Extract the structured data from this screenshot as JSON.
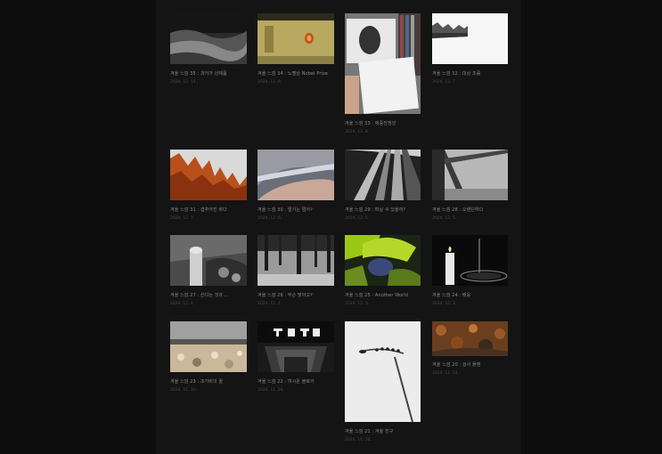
{
  "posts": [
    {
      "title": "겨울 느낌 35 : 과거가 완제품",
      "date": "2024. 12. 14."
    },
    {
      "title": "겨울 느낌 34 : 노벨상 Nobel Prize",
      "date": "2024. 12. 9."
    },
    {
      "title": "겨울 느낌 33 : 애증전쟁앙",
      "date": "2024. 12. 8."
    },
    {
      "title": "겨울 느낌 32 : 대상 조률",
      "date": "2024. 12. 7."
    },
    {
      "title": "겨울 느낌 31 : 겹추어진 바다",
      "date": "2024. 12. 7."
    },
    {
      "title": "겨울 느낌 30 : 멀기는 멀어?",
      "date": "2024. 12. 6."
    },
    {
      "title": "겨울 느낌 29 : 떠날 수 있을까?",
      "date": "2024. 12. 5."
    },
    {
      "title": "겨울 느낌 28 : 오렌딘하다",
      "date": "2024. 12. 5."
    },
    {
      "title": "겨울 느낌 27 : 산다는 것과 ...",
      "date": "2024. 12. 4."
    },
    {
      "title": "겨울 느낌 26 : 무슨 맞아고?",
      "date": "2024. 12. 4."
    },
    {
      "title": "겨울 느낌 25 : Another World",
      "date": "2024. 12. 3."
    },
    {
      "title": "겨울 느낌 24 : 배웅",
      "date": "2024. 12. 3."
    },
    {
      "title": "겨울 느낌 23 : 조가비의 꿈",
      "date": "2024. 11. 30."
    },
    {
      "title": "겨울 느낌 22 : 여시문 블로키",
      "date": "2024. 11. 28."
    },
    {
      "title": "겨울 느낌 21 : 겨울 친구",
      "date": "2024. 11. 28."
    },
    {
      "title": "겨울 느낌 20 : 검사 플랜",
      "date": "2024. 11. 24."
    }
  ]
}
